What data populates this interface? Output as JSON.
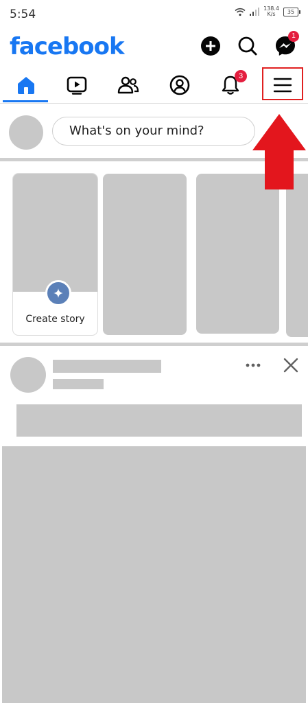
{
  "status_bar": {
    "time": "5:54",
    "network_speed_value": "138.4",
    "network_speed_unit": "K/s",
    "battery": "35"
  },
  "header": {
    "logo": "facebook",
    "brand_color": "#1877f2",
    "messenger_badge": "1",
    "icons": [
      "plus-icon",
      "search-icon",
      "messenger-icon"
    ]
  },
  "nav": {
    "tabs": [
      "home-icon",
      "video-icon",
      "friends-icon",
      "profile-icon",
      "bell-icon",
      "menu-icon"
    ],
    "active_tab": "home",
    "notifications_badge": "3"
  },
  "composer": {
    "placeholder": "What's on your mind?"
  },
  "stories": {
    "create_label": "Create story"
  },
  "annotation": {
    "highlight_color": "#e02020",
    "target": "menu-icon"
  }
}
